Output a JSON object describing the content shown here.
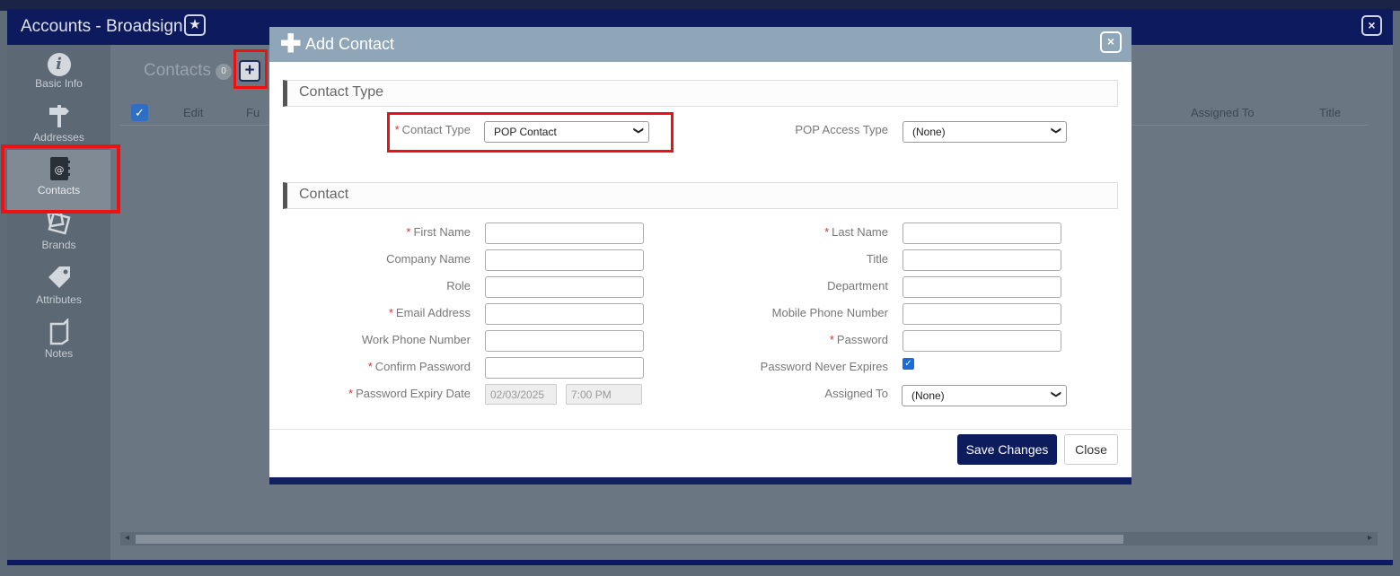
{
  "window": {
    "title": "Accounts - Broadsign",
    "star_icon": "★",
    "close_icon": "×"
  },
  "sidebar": {
    "items": [
      {
        "label": "Basic Info",
        "icon": "info-icon"
      },
      {
        "label": "Addresses",
        "icon": "signpost-icon"
      },
      {
        "label": "Contacts",
        "icon": "address-book-icon"
      },
      {
        "label": "Brands",
        "icon": "brands-icon"
      },
      {
        "label": "Attributes",
        "icon": "tags-icon"
      },
      {
        "label": "Notes",
        "icon": "note-icon"
      }
    ]
  },
  "main": {
    "heading": "Contacts",
    "count": "0",
    "add_icon": "+",
    "columns": [
      "Edit",
      "Fu",
      "Assigned To",
      "Title"
    ]
  },
  "modal": {
    "title": "Add Contact",
    "plus_icon": "✚",
    "close_icon": "×",
    "section_contact_type": "Contact Type",
    "section_contact": "Contact",
    "contact_type_label": "Contact Type",
    "contact_type_value": "POP Contact",
    "pop_access_type_label": "POP Access Type",
    "pop_access_type_value": "(None)",
    "fields": {
      "first_name": "First Name",
      "last_name": "Last Name",
      "company_name": "Company Name",
      "title": "Title",
      "role": "Role",
      "department": "Department",
      "email_address": "Email Address",
      "mobile_phone_number": "Mobile Phone Number",
      "work_phone_number": "Work Phone Number",
      "password": "Password",
      "confirm_password": "Confirm Password",
      "password_never_expires": "Password Never Expires",
      "password_expiry_date": "Password Expiry Date",
      "assigned_to": "Assigned To"
    },
    "expiry_date_value": "02/03/2025",
    "expiry_time_value": "7:00 PM",
    "assigned_to_value": "(None)",
    "password_never_expires_checked": true,
    "required_marker": "*",
    "save_label": "Save Changes",
    "close_label": "Close"
  },
  "colors": {
    "title_bar": "#0e1a5e",
    "modal_header": "#8fa6b8",
    "primary_button": "#0c1c5c",
    "highlight": "#ee1111",
    "required": "#e03030"
  }
}
